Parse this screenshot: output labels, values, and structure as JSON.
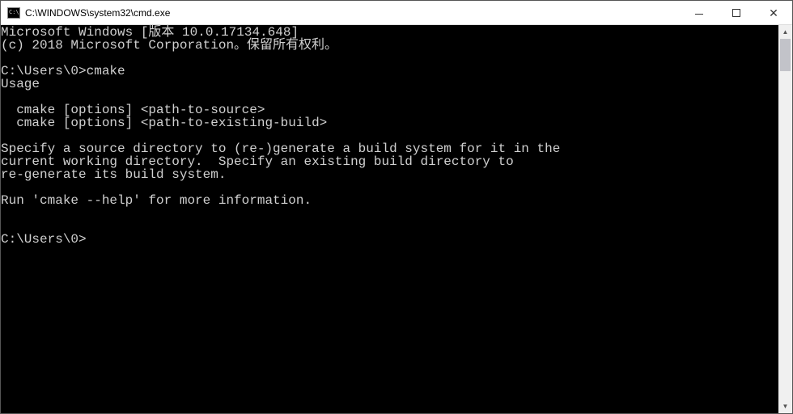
{
  "window": {
    "title": "C:\\WINDOWS\\system32\\cmd.exe"
  },
  "console": {
    "lines": [
      "Microsoft Windows [版本 10.0.17134.648]",
      "(c) 2018 Microsoft Corporation。保留所有权利。",
      "",
      "C:\\Users\\0>cmake",
      "Usage",
      "",
      "  cmake [options] <path-to-source>",
      "  cmake [options] <path-to-existing-build>",
      "",
      "Specify a source directory to (re-)generate a build system for it in the",
      "current working directory.  Specify an existing build directory to",
      "re-generate its build system.",
      "",
      "Run 'cmake --help' for more information.",
      "",
      "",
      "C:\\Users\\0>"
    ]
  }
}
